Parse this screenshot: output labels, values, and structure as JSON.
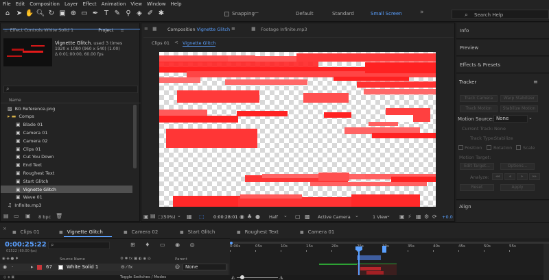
{
  "menu": [
    "File",
    "Edit",
    "Composition",
    "Layer",
    "Effect",
    "Animation",
    "View",
    "Window",
    "Help"
  ],
  "toolbar": {
    "snapping_label": "Snapping",
    "workspaces": [
      "Default",
      "Standard",
      "Small Screen"
    ],
    "active_workspace": "Small Screen",
    "search_placeholder": "Search Help"
  },
  "left_panel": {
    "tab_effect_controls": "Effect Controls White Solid 1",
    "tab_project": "Project",
    "project_name": "Vignette Glitch",
    "used": ", used 3 times",
    "dims": "1920 x 1080  (960 x 540) (1.00)",
    "duration": "Δ 0:01:00:00, 60.00 fps",
    "search_placeholder": "",
    "name_header": "Name",
    "items": [
      {
        "label": "BG Reference.png",
        "kind": "file",
        "indent": 0
      },
      {
        "label": "Comps",
        "kind": "folder",
        "indent": 0
      },
      {
        "label": "Blade 01",
        "kind": "comp",
        "indent": 1
      },
      {
        "label": "Camera 01",
        "kind": "comp",
        "indent": 1
      },
      {
        "label": "Camera 02",
        "kind": "comp",
        "indent": 1
      },
      {
        "label": "Clips 01",
        "kind": "comp",
        "indent": 1
      },
      {
        "label": "Cut You Down",
        "kind": "comp",
        "indent": 1
      },
      {
        "label": "End Text",
        "kind": "comp",
        "indent": 1
      },
      {
        "label": "Roughest Text",
        "kind": "comp",
        "indent": 1
      },
      {
        "label": "Start Glitch",
        "kind": "comp",
        "indent": 1
      },
      {
        "label": "Vignette Glitch",
        "kind": "comp",
        "indent": 1,
        "selected": true
      },
      {
        "label": "Wave 01",
        "kind": "comp",
        "indent": 1
      },
      {
        "label": "Infinite.mp3",
        "kind": "audio",
        "indent": 0
      }
    ],
    "bpc": "8 bpc"
  },
  "comp_panel": {
    "composition_label": "Composition",
    "composition_name": "Vignette Glitch",
    "footage_label": "Footage",
    "footage_name": "Infinite.mp3",
    "breadcrumb_prev": "Clips 01",
    "breadcrumb_current": "Vignette Glitch",
    "zoom": "(50%)",
    "timecode": "0:00:28:01",
    "resolution": "Half",
    "camera": "Active Camera",
    "view": "1 View",
    "offset": "+0.0"
  },
  "right_panel": {
    "sections": [
      "Info",
      "Preview",
      "Effects & Presets"
    ],
    "tracker_title": "Tracker",
    "tracker_buttons": [
      [
        "Track Camera",
        "Warp Stabilizer"
      ],
      [
        "Track Motion",
        "Stabilize Motion"
      ]
    ],
    "motion_source_label": "Motion Source:",
    "motion_source_value": "None",
    "current_track_label": "Current Track:",
    "current_track_value": "None",
    "track_type_label": "Track Type:",
    "track_type_value": "Stabilize",
    "checkboxes": [
      "Position",
      "Rotation",
      "Scale"
    ],
    "motion_target_label": "Motion Target:",
    "edit_target": "Edit Target...",
    "options": "Options...",
    "analyze_label": "Analyze:",
    "reset": "Reset",
    "apply": "Apply",
    "align": "Align"
  },
  "timeline": {
    "tabs": [
      "Clips 01",
      "Vignette Glitch",
      "Camera 02",
      "Start Glitch",
      "Roughest Text",
      "Camera 01"
    ],
    "active_tab": "Vignette Glitch",
    "timecode": "0:00:25:22",
    "frame_info": "01522 (60.00 fps)",
    "source_name_header": "Source Name",
    "parent_header": "Parent",
    "layer_number": "67",
    "layer_name": "White Solid 1",
    "layer_parent": "None",
    "toggle_label": "Toggle Switches / Modes",
    "ticks": [
      "0:00s",
      "05s",
      "10s",
      "15s",
      "20s",
      "25s",
      "30s",
      "35s",
      "40s",
      "45s",
      "50s",
      "55s"
    ]
  }
}
